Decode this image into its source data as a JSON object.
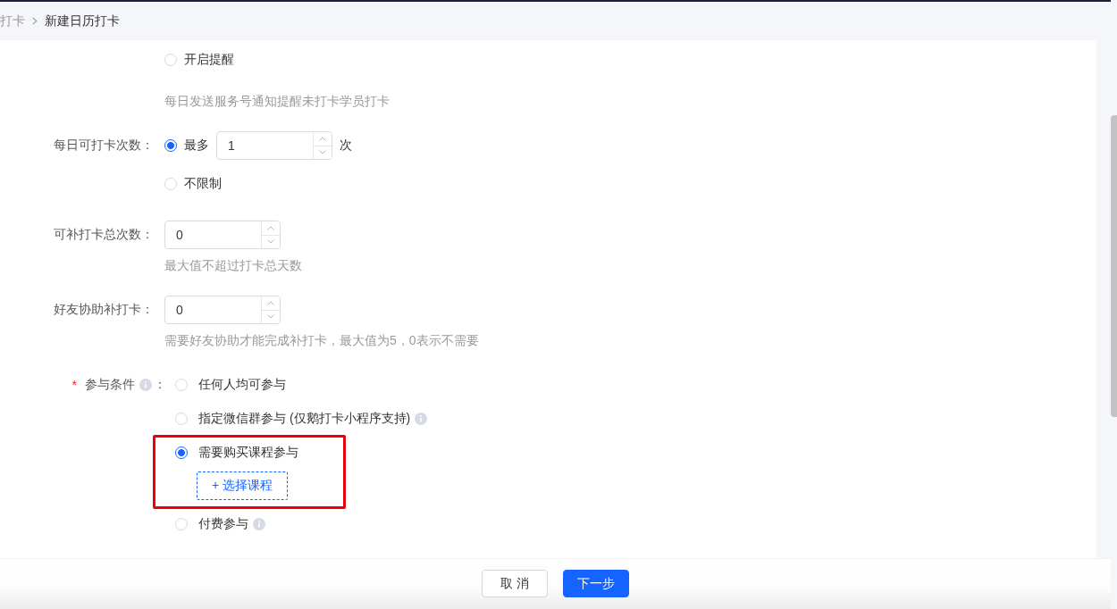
{
  "breadcrumb": [
    {
      "label": "打卡",
      "current": false
    },
    {
      "label": "新建日历打卡",
      "current": true
    }
  ],
  "fields": [
    {
      "kind": "radios",
      "options": [
        {
          "label": "开启提醒",
          "selected": false
        }
      ],
      "hint": "每日发送服务号通知提醒未打卡学员打卡"
    },
    {
      "kind": "radios",
      "label": "每日可打卡次数：",
      "options": [
        {
          "label": "最多",
          "selected": true,
          "input": "1",
          "suffix": "次"
        },
        {
          "label": "不限制",
          "selected": false
        }
      ]
    },
    {
      "kind": "number",
      "label": "可补打卡总次数：",
      "value": "0",
      "hint": "最大值不超过打卡总天数"
    },
    {
      "kind": "number",
      "label": "好友协助补打卡：",
      "value": "0",
      "hint": "需要好友协助才能完成补打卡，最大值为5，0表示不需要"
    },
    {
      "kind": "radios",
      "required_mark": "*",
      "label": "参与条件",
      "info_icon": true,
      "label_colon": "：",
      "options": [
        {
          "label": "任何人均可参与",
          "selected": false
        },
        {
          "label": "指定微信群参与 (仅鹅打卡小程序支持)",
          "selected": false,
          "info_icon": true
        },
        {
          "label": "需要购买课程参与",
          "selected": true,
          "highlighted": true,
          "button": "+ 选择课程"
        },
        {
          "label": "付费参与",
          "selected": false,
          "info_icon": true
        }
      ]
    }
  ],
  "footer": {
    "buttons": [
      {
        "label": "取 消",
        "kind": "default"
      },
      {
        "label": "下一步",
        "kind": "primary"
      }
    ]
  }
}
